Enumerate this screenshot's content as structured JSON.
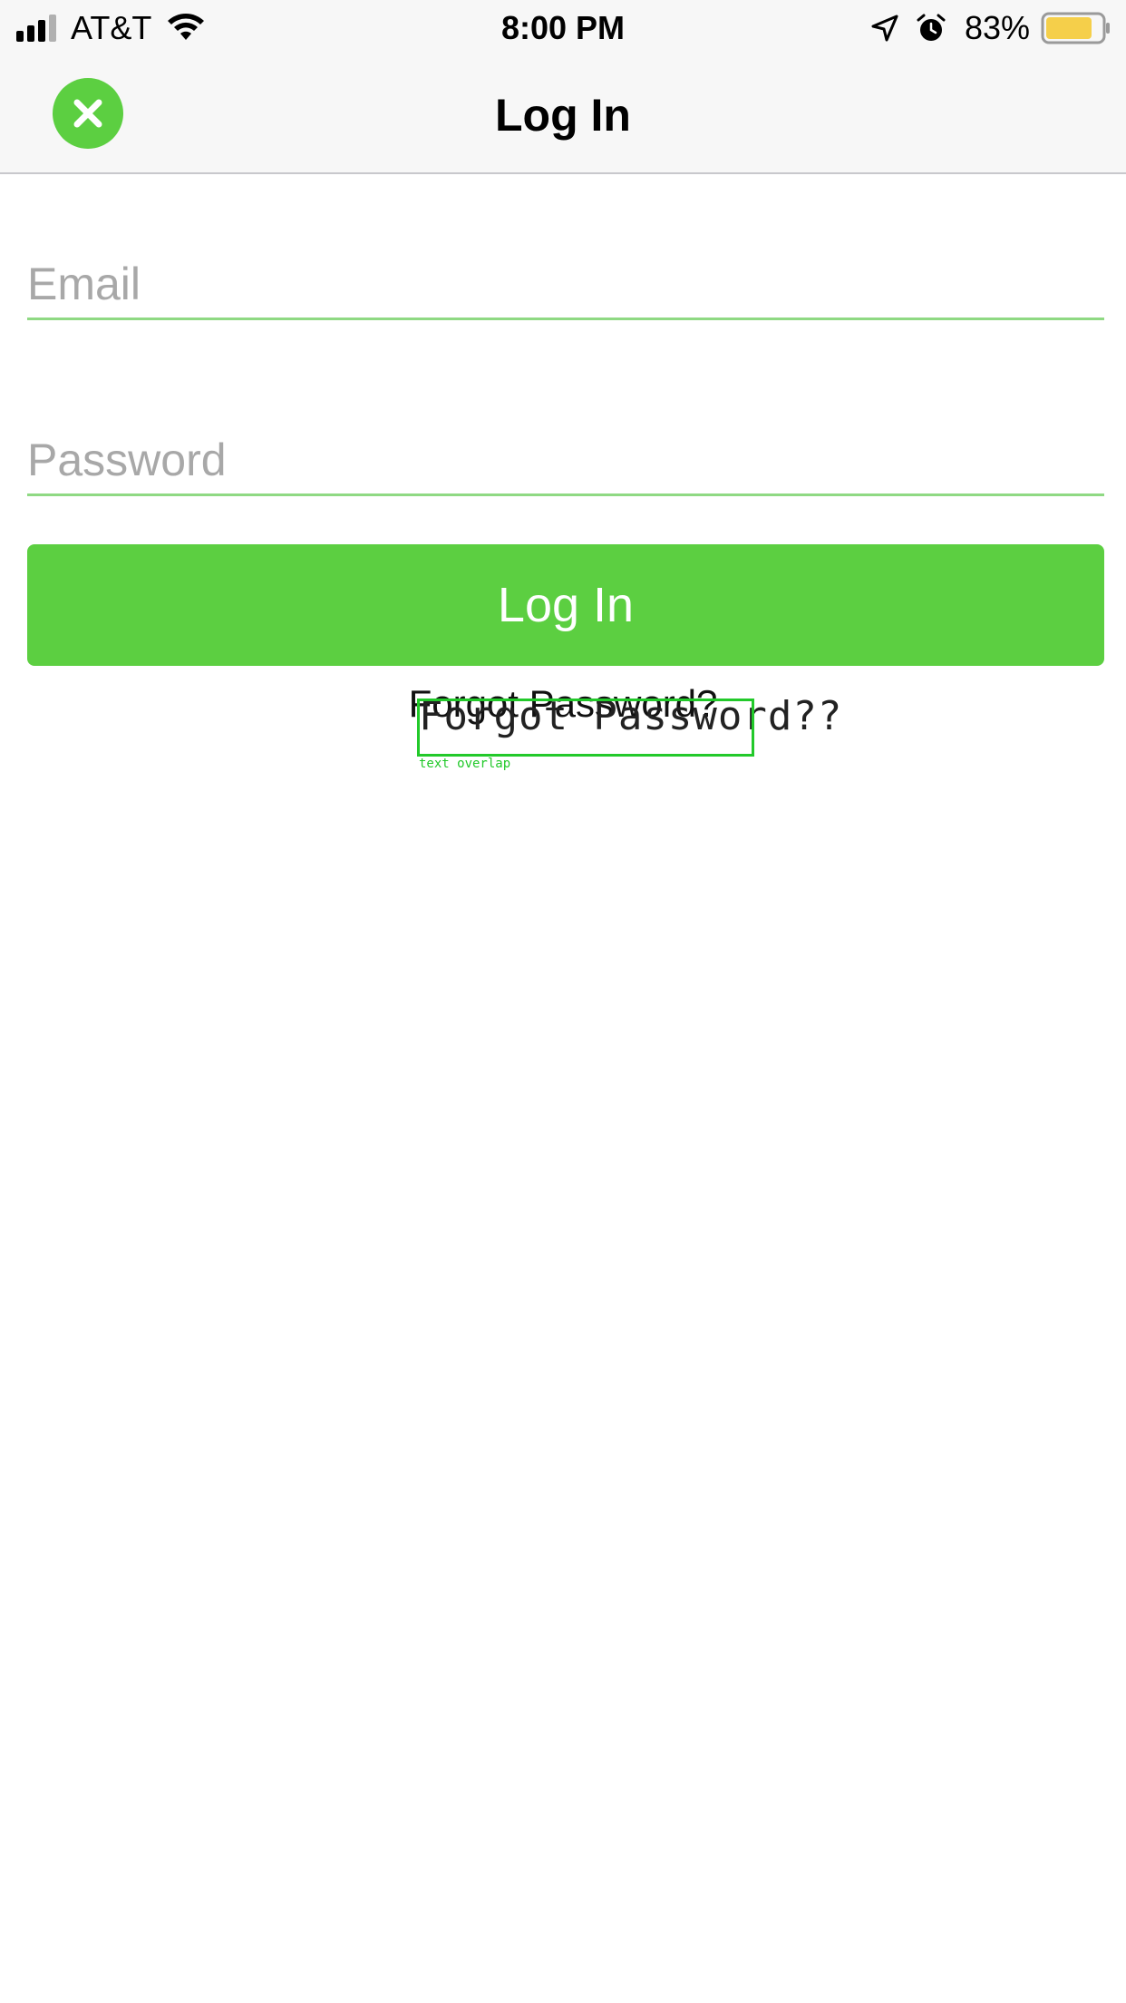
{
  "status_bar": {
    "carrier": "AT&T",
    "time": "8:00 PM",
    "battery_percent": "83%",
    "battery_level": 0.83,
    "battery_color": "#f5cf4a",
    "icons": [
      "signal-icon",
      "wifi-icon",
      "location-arrow-icon",
      "alarm-icon",
      "battery-icon"
    ]
  },
  "nav": {
    "title": "Log In",
    "close_icon": "close-icon",
    "accent_color": "#5ccf41"
  },
  "form": {
    "email": {
      "placeholder": "Email",
      "value": ""
    },
    "password": {
      "placeholder": "Password",
      "value": ""
    },
    "login_label": "Log In",
    "forgot_label": "Forgot Password?"
  },
  "overlay": {
    "text": "Forgot Password??",
    "tag": "text overlap",
    "color": "#22c92a"
  }
}
